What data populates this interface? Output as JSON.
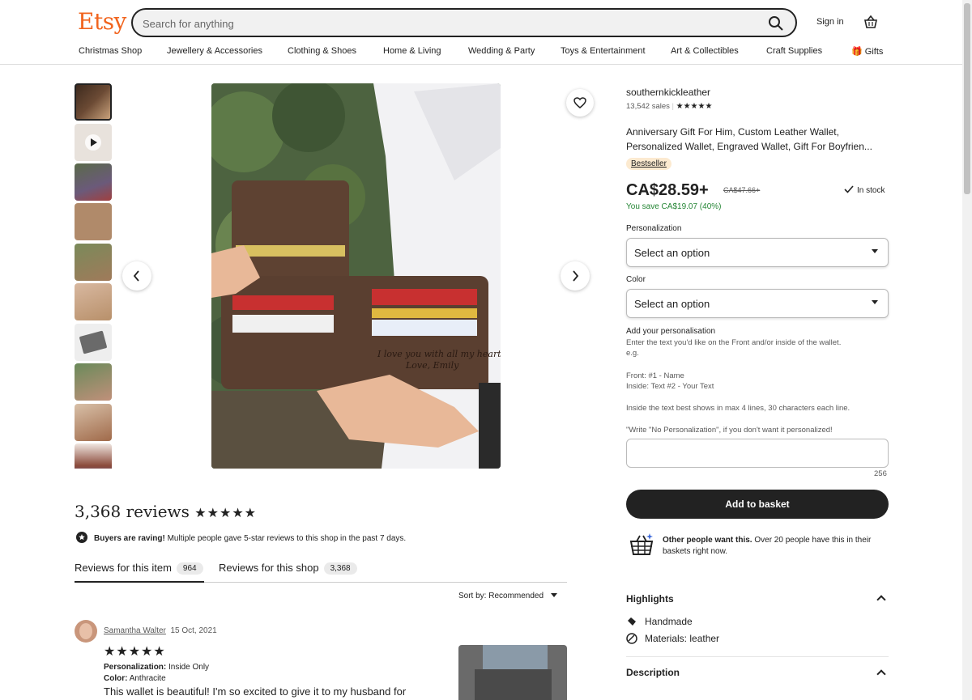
{
  "header": {
    "logo": "Etsy",
    "search_placeholder": "Search for anything",
    "signin": "Sign in",
    "nav": [
      "Christmas Shop",
      "Jewellery & Accessories",
      "Clothing & Shoes",
      "Home & Living",
      "Wedding & Party",
      "Toys & Entertainment",
      "Art & Collectibles",
      "Craft Supplies",
      "Gifts"
    ]
  },
  "product": {
    "shop": "southernkickleather",
    "sales": "13,542 sales",
    "title_line1": "Anniversary Gift For Him, Custom Leather Wallet,",
    "title_line2": "Personalized Wallet, Engraved Wallet, Gift For Boyfrien...",
    "badge": "Bestseller",
    "price": "CA$28.59+",
    "old_price": "CA$47.66+",
    "stock": "In stock",
    "save": "You save CA$19.07 (40%)",
    "personalization_label": "Personalization",
    "select1": "Select an option",
    "color_label": "Color",
    "select2": "Select an option",
    "add_personalisation": "Add your personalisation",
    "instr1": "Enter the text you'd like on the Front and/or inside of the wallet.",
    "instr2": "e.g.",
    "instr3": "Front: #1 - Name",
    "instr4": "Inside: Text #2 - Your Text",
    "instr5": "Inside the text best shows in max 4 lines, 30 characters each line.",
    "instr6": "\"Write \"No Personalization\", if you don't want it personalized!",
    "counter": "256",
    "add_to_basket": "Add to basket",
    "other_bold": "Other people want this.",
    "other_text": " Over 20 people have this in their baskets right now.",
    "highlights": "Highlights",
    "highlight_items": [
      "Handmade",
      "Materials: leather"
    ],
    "description": "Description"
  },
  "reviews": {
    "title": "3,368 reviews",
    "stars": "★★★★★",
    "raving_bold": "Buyers are raving!",
    "raving_text": " Multiple people gave 5-star reviews to this shop in the past 7 days.",
    "tab_item": "Reviews for this item",
    "tab_item_count": "964",
    "tab_shop": "Reviews for this shop",
    "tab_shop_count": "3,368",
    "sort": "Sort by: Recommended",
    "reviewer": "Samantha Walter",
    "date": "15 Oct, 2021",
    "review_stars": "★★★★★",
    "personalization_key": "Personalization:",
    "personalization_val": "Inside Only",
    "color_key": "Color:",
    "color_val": "Anthracite",
    "text": "This wallet is beautiful! I'm so excited to give it to my husband for"
  },
  "colors": {
    "brand": "#f1641e",
    "save_green": "#258635",
    "badge_bg": "#fcead0"
  }
}
